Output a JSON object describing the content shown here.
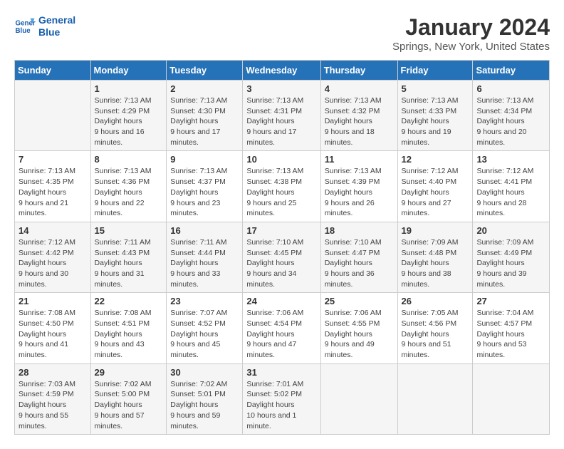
{
  "header": {
    "logo_line1": "General",
    "logo_line2": "Blue",
    "title": "January 2024",
    "subtitle": "Springs, New York, United States"
  },
  "days_of_week": [
    "Sunday",
    "Monday",
    "Tuesday",
    "Wednesday",
    "Thursday",
    "Friday",
    "Saturday"
  ],
  "weeks": [
    [
      {
        "day": "",
        "sunrise": "",
        "sunset": "",
        "daylight": ""
      },
      {
        "day": "1",
        "sunrise": "7:13 AM",
        "sunset": "4:29 PM",
        "daylight": "9 hours and 16 minutes."
      },
      {
        "day": "2",
        "sunrise": "7:13 AM",
        "sunset": "4:30 PM",
        "daylight": "9 hours and 17 minutes."
      },
      {
        "day": "3",
        "sunrise": "7:13 AM",
        "sunset": "4:31 PM",
        "daylight": "9 hours and 17 minutes."
      },
      {
        "day": "4",
        "sunrise": "7:13 AM",
        "sunset": "4:32 PM",
        "daylight": "9 hours and 18 minutes."
      },
      {
        "day": "5",
        "sunrise": "7:13 AM",
        "sunset": "4:33 PM",
        "daylight": "9 hours and 19 minutes."
      },
      {
        "day": "6",
        "sunrise": "7:13 AM",
        "sunset": "4:34 PM",
        "daylight": "9 hours and 20 minutes."
      }
    ],
    [
      {
        "day": "7",
        "sunrise": "7:13 AM",
        "sunset": "4:35 PM",
        "daylight": "9 hours and 21 minutes."
      },
      {
        "day": "8",
        "sunrise": "7:13 AM",
        "sunset": "4:36 PM",
        "daylight": "9 hours and 22 minutes."
      },
      {
        "day": "9",
        "sunrise": "7:13 AM",
        "sunset": "4:37 PM",
        "daylight": "9 hours and 23 minutes."
      },
      {
        "day": "10",
        "sunrise": "7:13 AM",
        "sunset": "4:38 PM",
        "daylight": "9 hours and 25 minutes."
      },
      {
        "day": "11",
        "sunrise": "7:13 AM",
        "sunset": "4:39 PM",
        "daylight": "9 hours and 26 minutes."
      },
      {
        "day": "12",
        "sunrise": "7:12 AM",
        "sunset": "4:40 PM",
        "daylight": "9 hours and 27 minutes."
      },
      {
        "day": "13",
        "sunrise": "7:12 AM",
        "sunset": "4:41 PM",
        "daylight": "9 hours and 28 minutes."
      }
    ],
    [
      {
        "day": "14",
        "sunrise": "7:12 AM",
        "sunset": "4:42 PM",
        "daylight": "9 hours and 30 minutes."
      },
      {
        "day": "15",
        "sunrise": "7:11 AM",
        "sunset": "4:43 PM",
        "daylight": "9 hours and 31 minutes."
      },
      {
        "day": "16",
        "sunrise": "7:11 AM",
        "sunset": "4:44 PM",
        "daylight": "9 hours and 33 minutes."
      },
      {
        "day": "17",
        "sunrise": "7:10 AM",
        "sunset": "4:45 PM",
        "daylight": "9 hours and 34 minutes."
      },
      {
        "day": "18",
        "sunrise": "7:10 AM",
        "sunset": "4:47 PM",
        "daylight": "9 hours and 36 minutes."
      },
      {
        "day": "19",
        "sunrise": "7:09 AM",
        "sunset": "4:48 PM",
        "daylight": "9 hours and 38 minutes."
      },
      {
        "day": "20",
        "sunrise": "7:09 AM",
        "sunset": "4:49 PM",
        "daylight": "9 hours and 39 minutes."
      }
    ],
    [
      {
        "day": "21",
        "sunrise": "7:08 AM",
        "sunset": "4:50 PM",
        "daylight": "9 hours and 41 minutes."
      },
      {
        "day": "22",
        "sunrise": "7:08 AM",
        "sunset": "4:51 PM",
        "daylight": "9 hours and 43 minutes."
      },
      {
        "day": "23",
        "sunrise": "7:07 AM",
        "sunset": "4:52 PM",
        "daylight": "9 hours and 45 minutes."
      },
      {
        "day": "24",
        "sunrise": "7:06 AM",
        "sunset": "4:54 PM",
        "daylight": "9 hours and 47 minutes."
      },
      {
        "day": "25",
        "sunrise": "7:06 AM",
        "sunset": "4:55 PM",
        "daylight": "9 hours and 49 minutes."
      },
      {
        "day": "26",
        "sunrise": "7:05 AM",
        "sunset": "4:56 PM",
        "daylight": "9 hours and 51 minutes."
      },
      {
        "day": "27",
        "sunrise": "7:04 AM",
        "sunset": "4:57 PM",
        "daylight": "9 hours and 53 minutes."
      }
    ],
    [
      {
        "day": "28",
        "sunrise": "7:03 AM",
        "sunset": "4:59 PM",
        "daylight": "9 hours and 55 minutes."
      },
      {
        "day": "29",
        "sunrise": "7:02 AM",
        "sunset": "5:00 PM",
        "daylight": "9 hours and 57 minutes."
      },
      {
        "day": "30",
        "sunrise": "7:02 AM",
        "sunset": "5:01 PM",
        "daylight": "9 hours and 59 minutes."
      },
      {
        "day": "31",
        "sunrise": "7:01 AM",
        "sunset": "5:02 PM",
        "daylight": "10 hours and 1 minute."
      },
      {
        "day": "",
        "sunrise": "",
        "sunset": "",
        "daylight": ""
      },
      {
        "day": "",
        "sunrise": "",
        "sunset": "",
        "daylight": ""
      },
      {
        "day": "",
        "sunrise": "",
        "sunset": "",
        "daylight": ""
      }
    ]
  ]
}
